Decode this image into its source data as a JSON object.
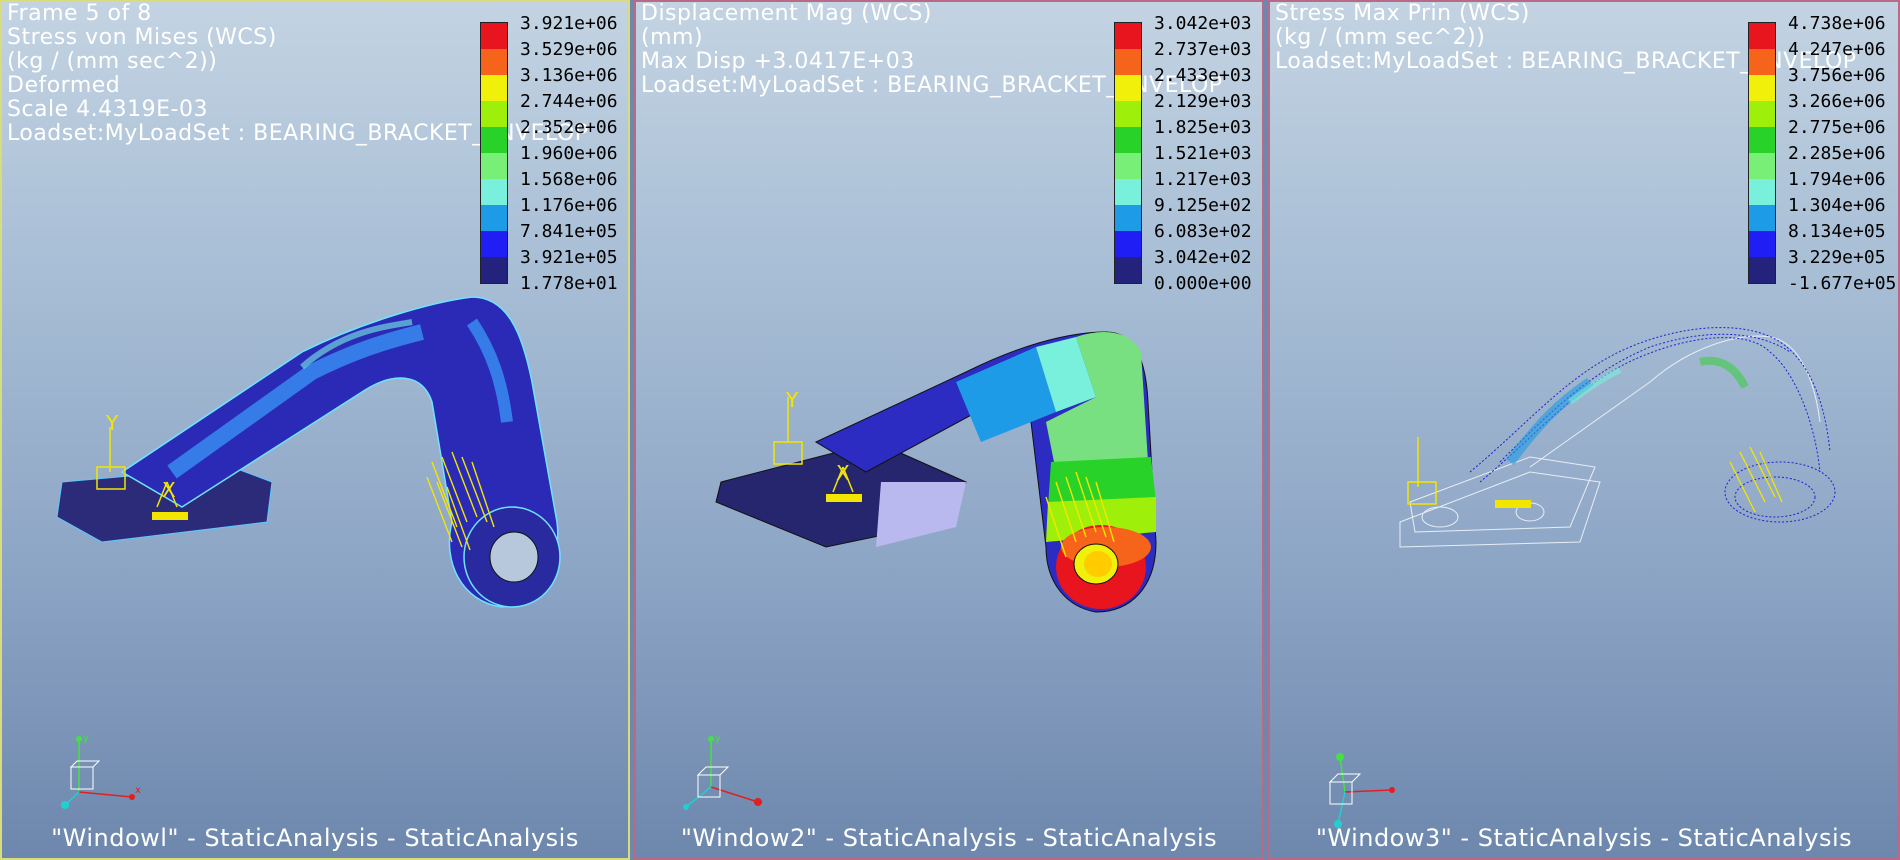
{
  "windows": [
    {
      "lines": [
        "Frame 5 of 8",
        "Stress von Mises (WCS)",
        "(kg / (mm sec^2))",
        "Deformed",
        "Scale  4.4319E-03",
        "Loadset:MyLoadSet :  BEARING_BRACKET_ENVELOP"
      ],
      "legend": [
        "3.921e+06",
        "3.529e+06",
        "3.136e+06",
        "2.744e+06",
        "2.352e+06",
        "1.960e+06",
        "1.568e+06",
        "1.176e+06",
        "7.841e+05",
        "3.921e+05",
        "1.778e+01"
      ],
      "caption": "\"Windowl\" - StaticAnalysis - StaticAnalysis"
    },
    {
      "lines": [
        "Displacement Mag (WCS)",
        "(mm)",
        "Max Disp  +3.0417E+03",
        "Loadset:MyLoadSet :  BEARING_BRACKET_ENVELOP"
      ],
      "legend": [
        "3.042e+03",
        "2.737e+03",
        "2.433e+03",
        "2.129e+03",
        "1.825e+03",
        "1.521e+03",
        "1.217e+03",
        "9.125e+02",
        "6.083e+02",
        "3.042e+02",
        "0.000e+00"
      ],
      "caption": "\"Window2\" - StaticAnalysis - StaticAnalysis"
    },
    {
      "lines": [
        "Stress Max Prin (WCS)",
        "(kg / (mm sec^2))",
        "Loadset:MyLoadSet :  BEARING_BRACKET_ENVELOP"
      ],
      "legend": [
        "4.738e+06",
        "4.247e+06",
        "3.756e+06",
        "3.266e+06",
        "2.775e+06",
        "2.285e+06",
        "1.794e+06",
        "1.304e+06",
        "8.134e+05",
        "3.229e+05",
        "-1.677e+05"
      ],
      "caption": "\"Window3\" - StaticAnalysis - StaticAnalysis"
    }
  ],
  "legend_colors": [
    "#e8141e",
    "#f5641a",
    "#f0f00a",
    "#9ef00a",
    "#28d228",
    "#78f078",
    "#78f0dc",
    "#1e9be6",
    "#1e1ef5",
    "#23237d"
  ],
  "triad_labels": {
    "y": "y",
    "x": "x",
    "z": "z"
  },
  "marker_labels": {
    "y": "Y",
    "x": "X"
  }
}
